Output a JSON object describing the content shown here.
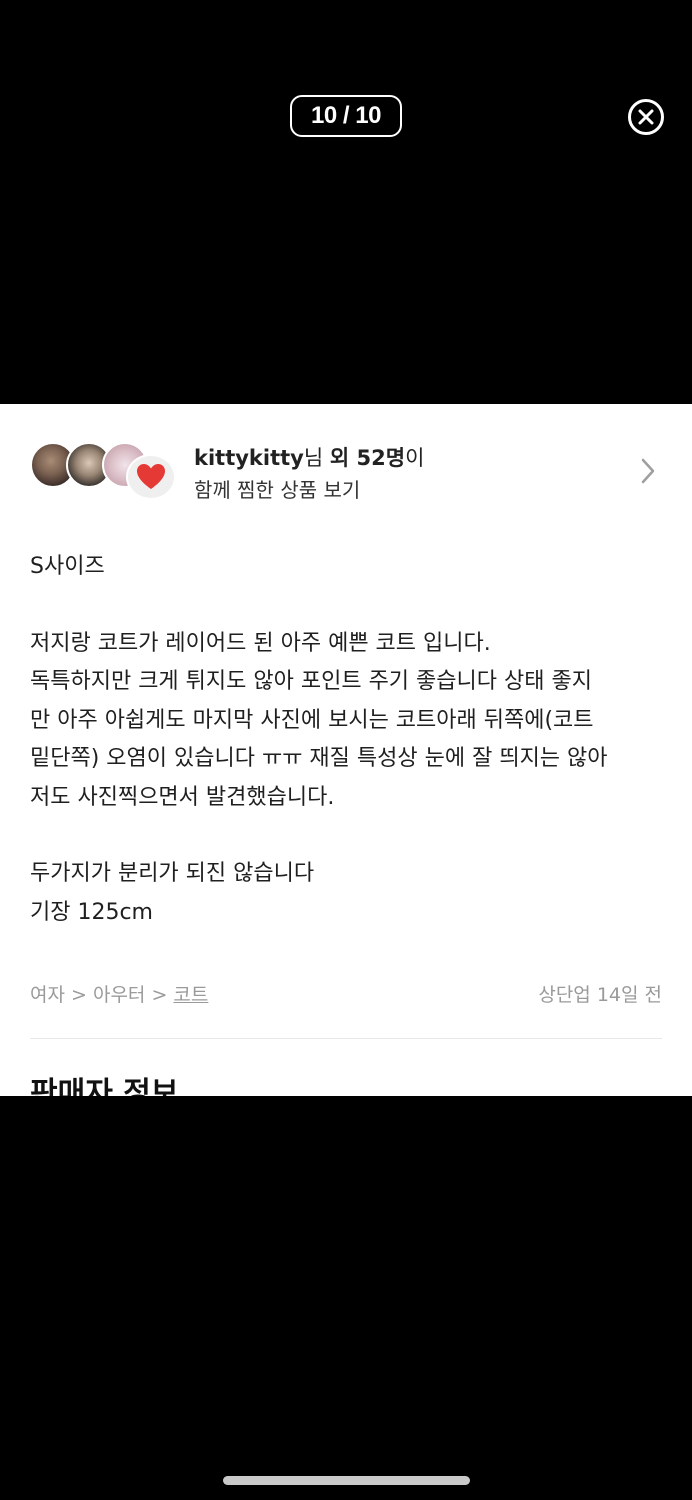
{
  "viewer": {
    "counter": "10 / 10"
  },
  "likers": {
    "name": "kittykitty",
    "suffix_nim": "님 ",
    "others_prefix": "외 ",
    "count": "52명",
    "suffix_i": "이",
    "subtitle": "함께 찜한 상품 보기"
  },
  "description": {
    "size_line": "S사이즈",
    "para1": [
      "저지랑 코트가 레이어드 된 아주 예쁜 코트 입니다.",
      "독특하지만 크게 튀지도 않아 포인트 주기 좋습니다 상태 좋지",
      "만 아주 아쉽게도 마지막 사진에 보시는 코트아래 뒤쪽에(코트",
      "밑단쪽) 오염이 있습니다 ㅠㅠ 재질 특성상 눈에 잘 띄지는 않아",
      "저도 사진찍으면서 발견했습니다."
    ],
    "para2": [
      "두가지가 분리가 되진 않습니다",
      "기장 125cm"
    ]
  },
  "meta": {
    "category_1": "여자",
    "separator": " > ",
    "category_2": "아우터",
    "category_3": "코트",
    "time": "상단업 14일 전"
  },
  "seller": {
    "heading": "판매자 정보"
  },
  "colors": {
    "background": "#000000",
    "card": "#ffffff",
    "heart": "#e53935"
  },
  "icons": {
    "close": "close-circle-icon",
    "chevron": "chevron-right-icon",
    "heart": "heart-icon"
  }
}
